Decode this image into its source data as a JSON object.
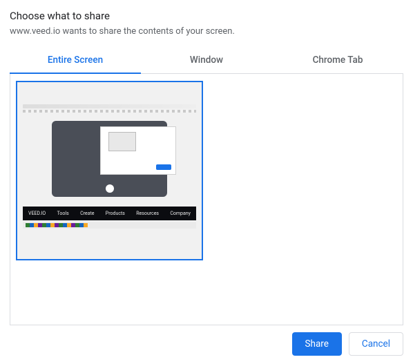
{
  "heading": "Choose what to share",
  "subtitle": "www.veed.io wants to share the contents of your screen.",
  "tabs": {
    "entire_screen": "Entire Screen",
    "window": "Window",
    "chrome_tab": "Chrome Tab"
  },
  "active_tab": "entire_screen",
  "preview": {
    "brand": "VEED.IO",
    "nav": [
      "Tools",
      "Create",
      "Products",
      "Resources",
      "Company"
    ]
  },
  "buttons": {
    "share": "Share",
    "cancel": "Cancel"
  }
}
